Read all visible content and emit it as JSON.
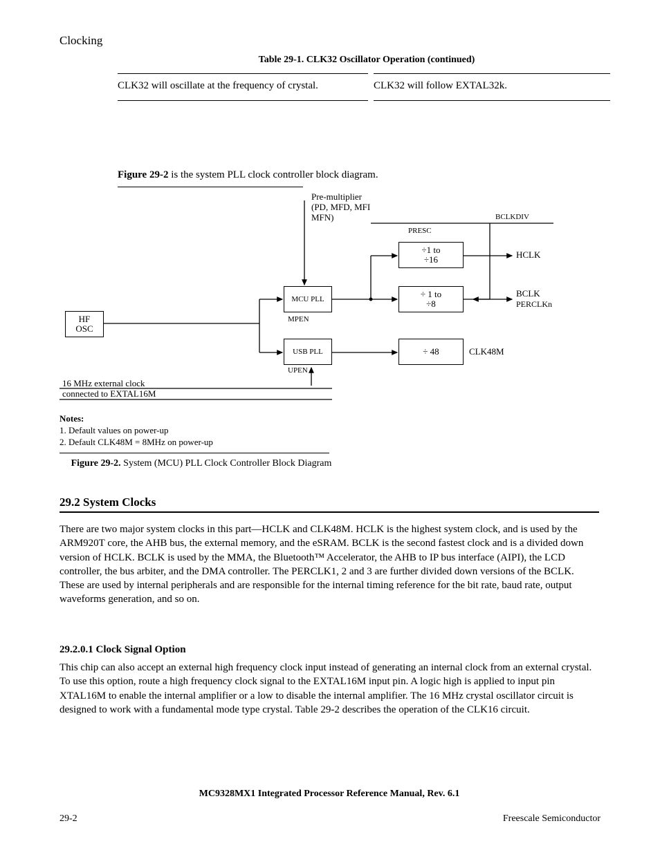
{
  "header": "MC9328MX1 Integrated Processor Reference Manual, Rev. 6.1",
  "table": {
    "headers": [
      "Table 29-1.   CLK32 Oscillator Operation  (continued)"
    ],
    "row": {
      "left": "CLK32 will oscillate at the frequency of crystal.",
      "right": "CLK32 will follow EXTAL32k."
    }
  },
  "figure": {
    "title_b": "Figure 29-2",
    "title_rest": " is the system PLL clock controller block diagram.",
    "boxes": {
      "osc": "HF\nOSC",
      "mcu_pll": "MCU PLL",
      "usb_pll": "USB PLL",
      "div1": "÷1 to\n÷16",
      "div2": "÷ 1 to\n÷8",
      "div48": "÷ 48"
    },
    "labels": {
      "premult": "Pre-multiplier\n(PD, MFD, MFI\nMFN)",
      "ext16": "16 MHz external clock\nconnected to EXTAL16M",
      "mpen": "MPEN",
      "upen": "UPEN",
      "presc": "PRESC",
      "bclkdiv": "BCLKDIV",
      "hclk": "HCLK",
      "bclk": "BCLK",
      "perclk": "PERCLKn",
      "clk48": "CLK48M"
    },
    "notes": [
      "1. Default values on power-up",
      "2. Default CLK48M = 8MHz on power-up"
    ],
    "caption_b": "Figure 29-2. ",
    "caption_rest": "System (MCU) PLL Clock Controller Block Diagram"
  },
  "section_title": "29.2 System Clocks",
  "p1": "There are two major system clocks in this part—HCLK and CLK48M. HCLK is the highest system clock, and is used by the ARM920T core, the AHB bus, the external memory, and the eSRAM. BCLK is the second fastest clock and is a divided down version of HCLK. BCLK is used by the MMA, the Bluetooth™ Accelerator, the AHB to IP bus interface (AIPI), the LCD controller, the bus arbiter, and the DMA controller. The PERCLK1, 2 and 3 are further divided down versions of the BCLK. These are used by internal peripherals and are responsible for the internal timing reference for the bit rate, baud rate, output waveforms generation, and so on.",
  "subhead": "29.2.0.1 Clock Signal Option",
  "p2": "This chip can also accept an external high frequency clock input instead of generating an internal clock from an external crystal. To use this option, route a high frequency clock signal to the EXTAL16M input pin. A logic high is applied to input pin XTAL16M to enable the internal amplifier or a low to disable the internal amplifier. The 16 MHz crystal oscillator circuit is designed to work with a fundamental mode type crystal. Table 29-2 describes the operation of the CLK16 circuit.",
  "page_num": "29-2",
  "footer": "Freescale Semiconductor",
  "clocking": "Clocking"
}
